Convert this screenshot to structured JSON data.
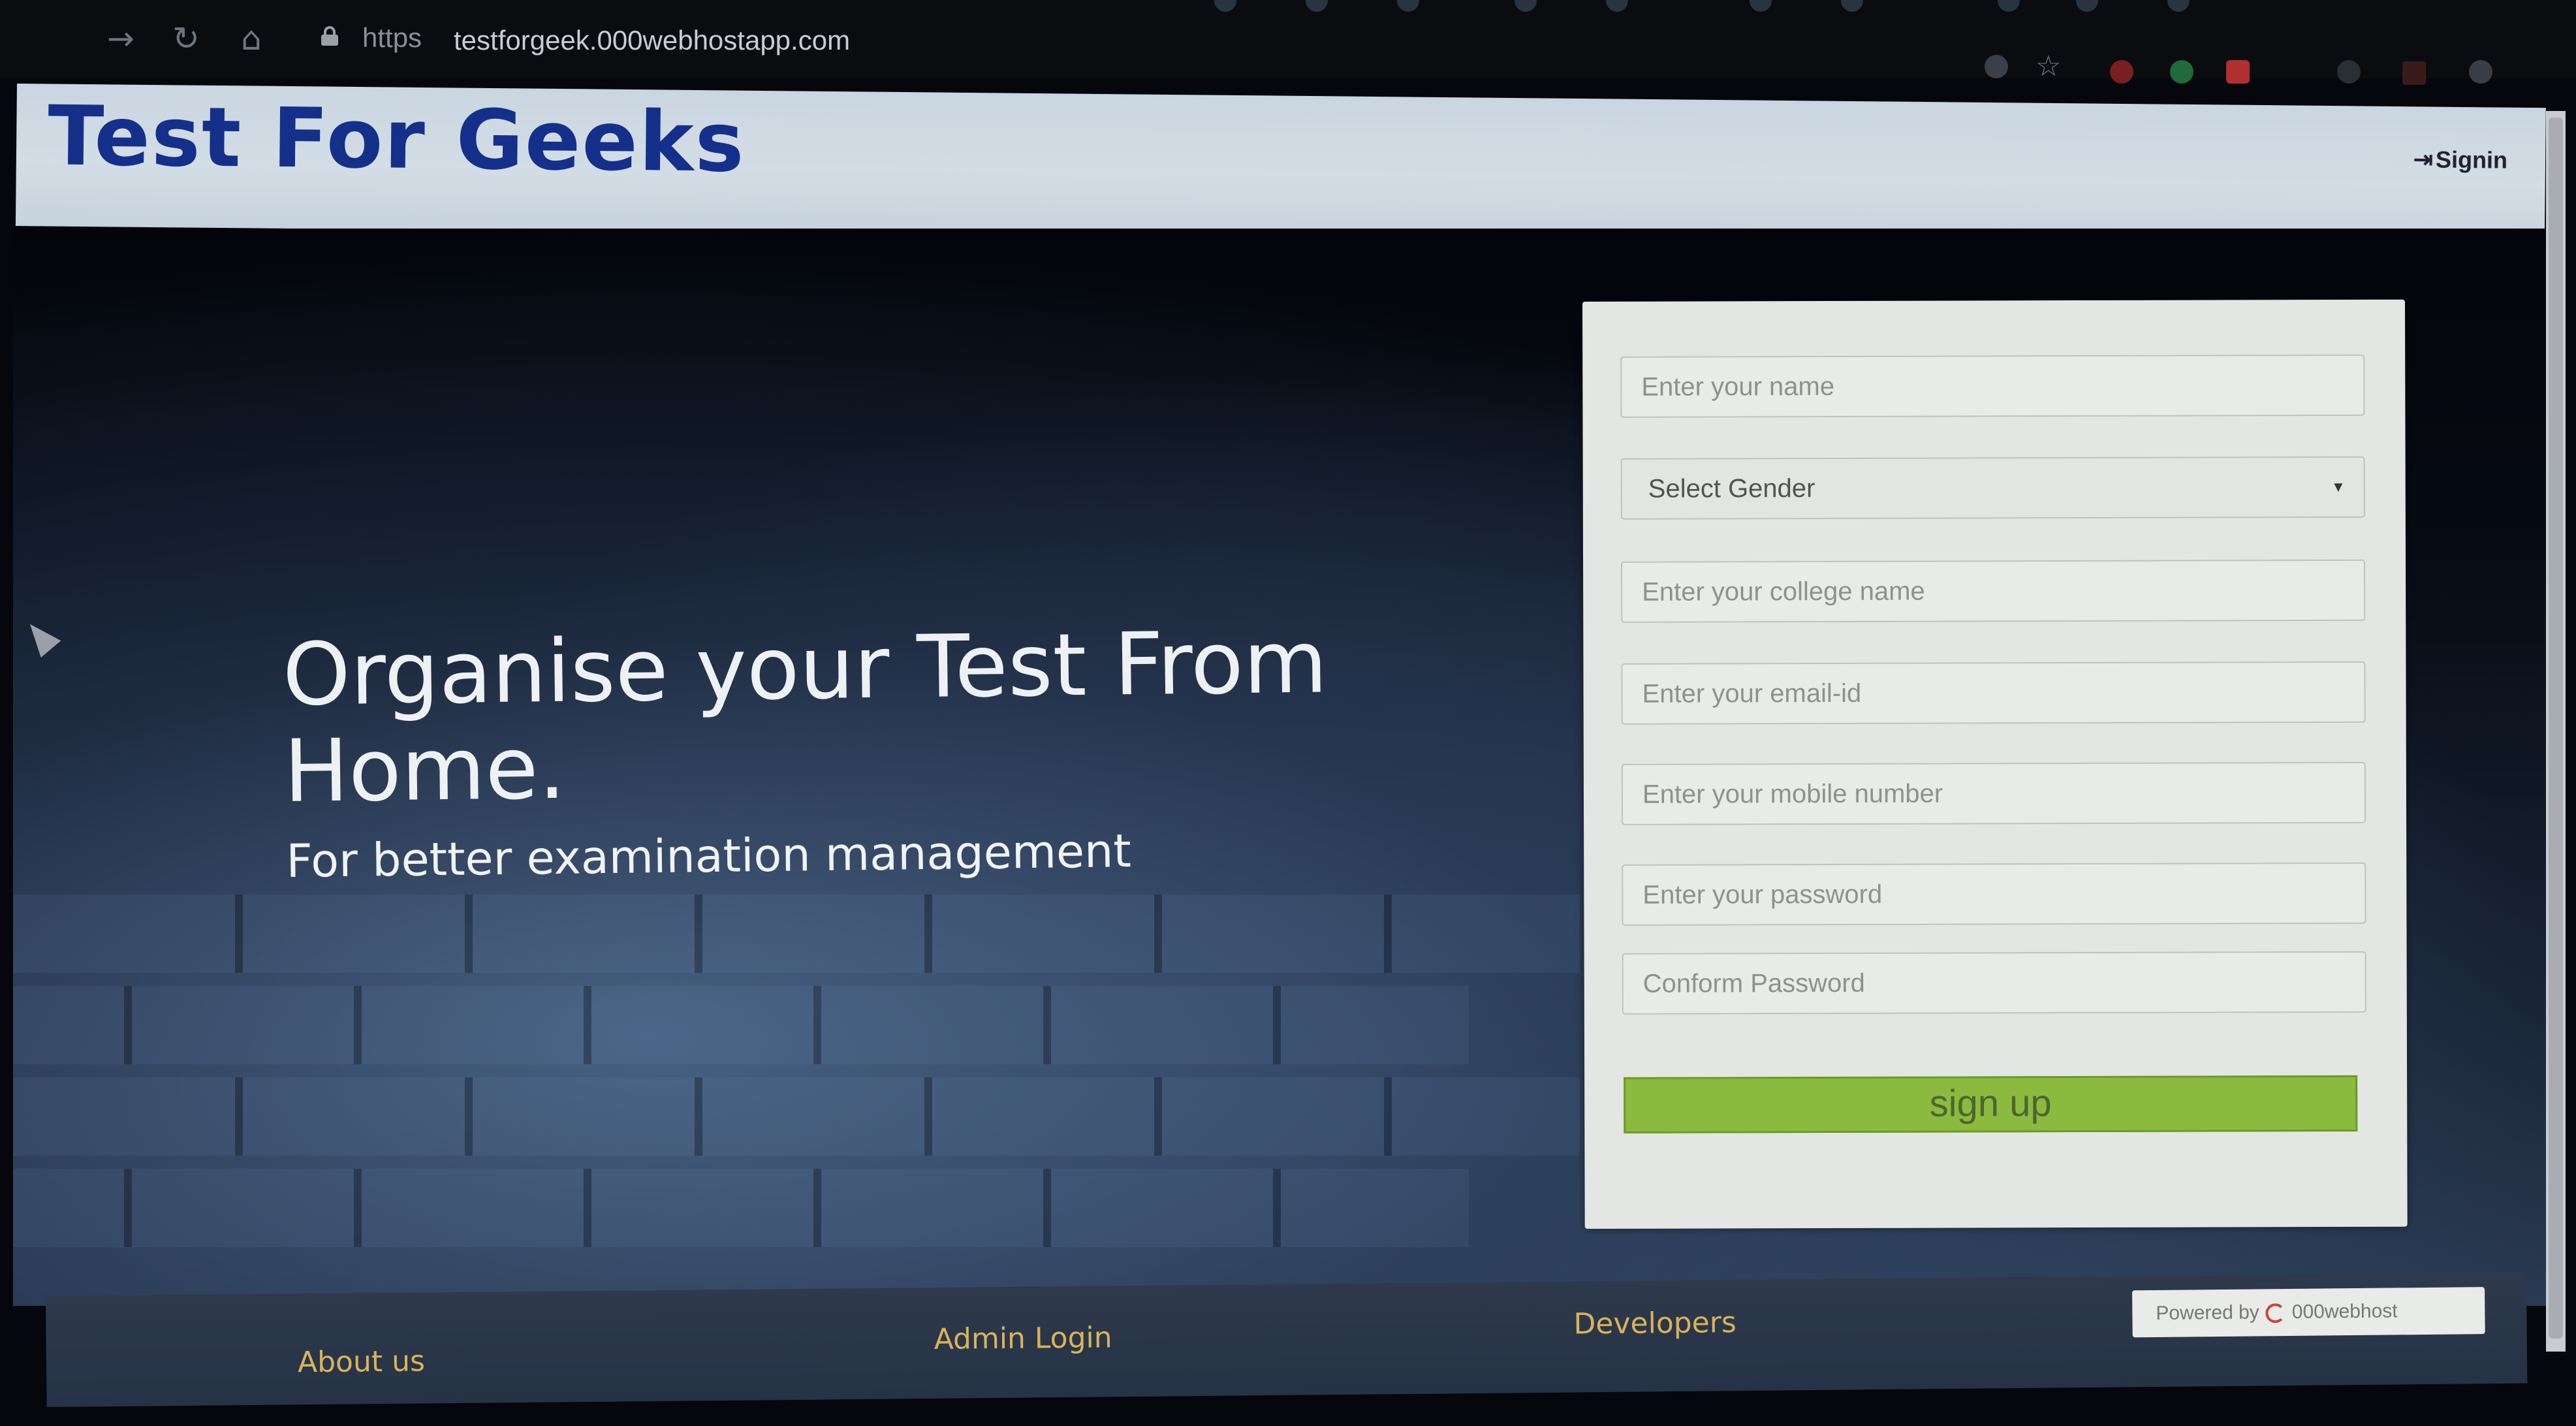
{
  "browser": {
    "url_scheme": "https",
    "url": "testforgeek.000webhostapp.com"
  },
  "header": {
    "logo": "Test For Geeks",
    "signin_label": "Signin"
  },
  "hero": {
    "title": "Organise your Test From Home.",
    "subtitle": "For better examination management"
  },
  "form": {
    "name_placeholder": "Enter your name",
    "gender_label": "Select Gender",
    "college_placeholder": "Enter your college name",
    "email_placeholder": "Enter your email-id",
    "mobile_placeholder": "Enter your mobile number",
    "password_placeholder": "Enter your password",
    "confirm_placeholder": "Conform Password",
    "submit_label": "sign up"
  },
  "footer": {
    "about": "About us",
    "admin": "Admin Login",
    "developers": "Developers",
    "powered_by": "Powered by",
    "host_name": "000webhost"
  },
  "colors": {
    "logo": "#15308a",
    "button": "#8bbb3e",
    "footer_link": "#d9b35a"
  }
}
